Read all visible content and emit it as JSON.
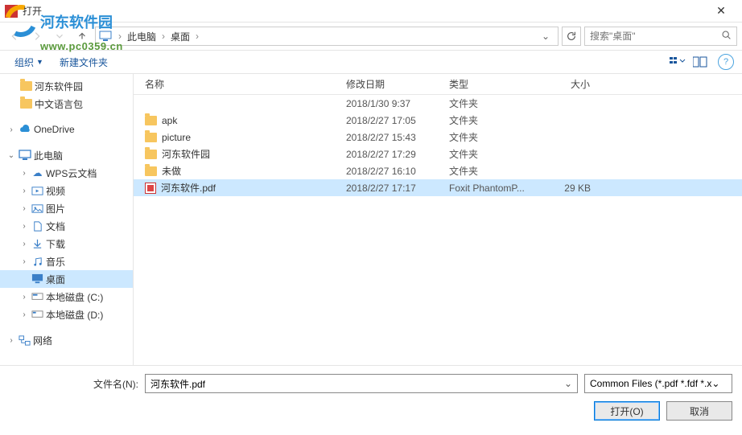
{
  "title": "打开",
  "watermark": {
    "text": "河东软件园",
    "url": "www.pc0359.cn"
  },
  "breadcrumb": {
    "root_icon": "monitor",
    "items": [
      "此电脑",
      "桌面"
    ]
  },
  "search": {
    "placeholder": "搜索\"桌面\""
  },
  "toolbar": {
    "organize": "组织",
    "new_folder": "新建文件夹"
  },
  "sidebar": {
    "quick": [
      {
        "label": "河东软件园",
        "icon": "folder"
      },
      {
        "label": "中文语言包",
        "icon": "folder"
      }
    ],
    "onedrive": {
      "label": "OneDrive"
    },
    "thispc": {
      "label": "此电脑"
    },
    "thispc_children": [
      {
        "label": "WPS云文档",
        "icon": "cloud-doc"
      },
      {
        "label": "视频",
        "icon": "video"
      },
      {
        "label": "图片",
        "icon": "pictures"
      },
      {
        "label": "文档",
        "icon": "documents"
      },
      {
        "label": "下载",
        "icon": "downloads"
      },
      {
        "label": "音乐",
        "icon": "music"
      },
      {
        "label": "桌面",
        "icon": "desktop",
        "selected": true
      },
      {
        "label": "本地磁盘 (C:)",
        "icon": "drive"
      },
      {
        "label": "本地磁盘 (D:)",
        "icon": "drive"
      }
    ],
    "network": {
      "label": "网络"
    }
  },
  "filelist": {
    "headers": {
      "name": "名称",
      "date": "修改日期",
      "type": "类型",
      "size": "大小"
    },
    "rows": [
      {
        "name": "",
        "date": "2018/1/30 9:37",
        "type": "文件夹",
        "size": "",
        "icon": "none"
      },
      {
        "name": "apk",
        "date": "2018/2/27 17:05",
        "type": "文件夹",
        "size": "",
        "icon": "folder"
      },
      {
        "name": "picture",
        "date": "2018/2/27 15:43",
        "type": "文件夹",
        "size": "",
        "icon": "folder"
      },
      {
        "name": "河东软件园",
        "date": "2018/2/27 17:29",
        "type": "文件夹",
        "size": "",
        "icon": "folder"
      },
      {
        "name": "未做",
        "date": "2018/2/27 16:10",
        "type": "文件夹",
        "size": "",
        "icon": "folder"
      },
      {
        "name": "河东软件.pdf",
        "date": "2018/2/27 17:17",
        "type": "Foxit PhantomP...",
        "size": "29 KB",
        "icon": "pdf",
        "selected": true
      }
    ]
  },
  "bottom": {
    "filename_label": "文件名(N):",
    "filename_value": "河东软件.pdf",
    "filter": "Common Files (*.pdf *.fdf *.x",
    "open_btn": "打开(O)",
    "cancel_btn": "取消"
  }
}
